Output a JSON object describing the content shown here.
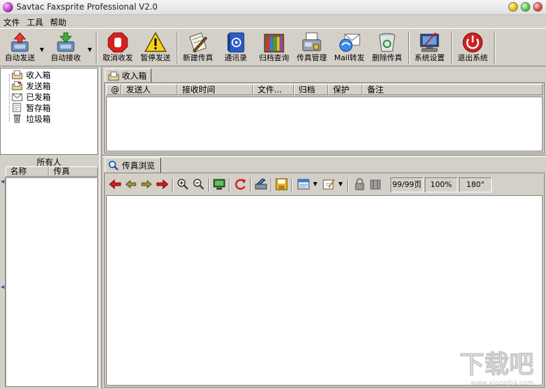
{
  "window": {
    "title": "Savtac Faxsprite Professional V2.0"
  },
  "menu": [
    "文件",
    "工具",
    "帮助"
  ],
  "toolbar": {
    "auto_send": "自动发送",
    "auto_receive": "自动接收",
    "cancel": "取消收发",
    "pause_send": "暂停发送",
    "new_fax": "新建传真",
    "address_book": "通讯录",
    "archive_query": "归档查询",
    "fax_manage": "传真管理",
    "mail_forward": "Mail转发",
    "delete_fax": "删除传真",
    "settings": "系统设置",
    "exit": "退出系统"
  },
  "folders": [
    "收入箱",
    "发送箱",
    "已发箱",
    "暂存箱",
    "垃圾箱"
  ],
  "contacts": {
    "title": "所有人",
    "columns": [
      "名称",
      "传真"
    ]
  },
  "inbox": {
    "tab": "收入箱",
    "columns": [
      "@",
      "发送人",
      "接收时间",
      "文件...",
      "归档",
      "保护",
      "备注"
    ]
  },
  "fax_view": {
    "tab": "传真浏览",
    "page_indicator": "99/99页",
    "zoom": "100%",
    "rotation": "180°"
  },
  "colors": {
    "window_bg": "#d4d0c8",
    "pane_bg": "#ffffff",
    "accent_red": "#cc2020",
    "accent_blue": "#2a5cc8"
  },
  "watermark": {
    "text": "下载吧",
    "url": "www.xiazaiba.com"
  }
}
